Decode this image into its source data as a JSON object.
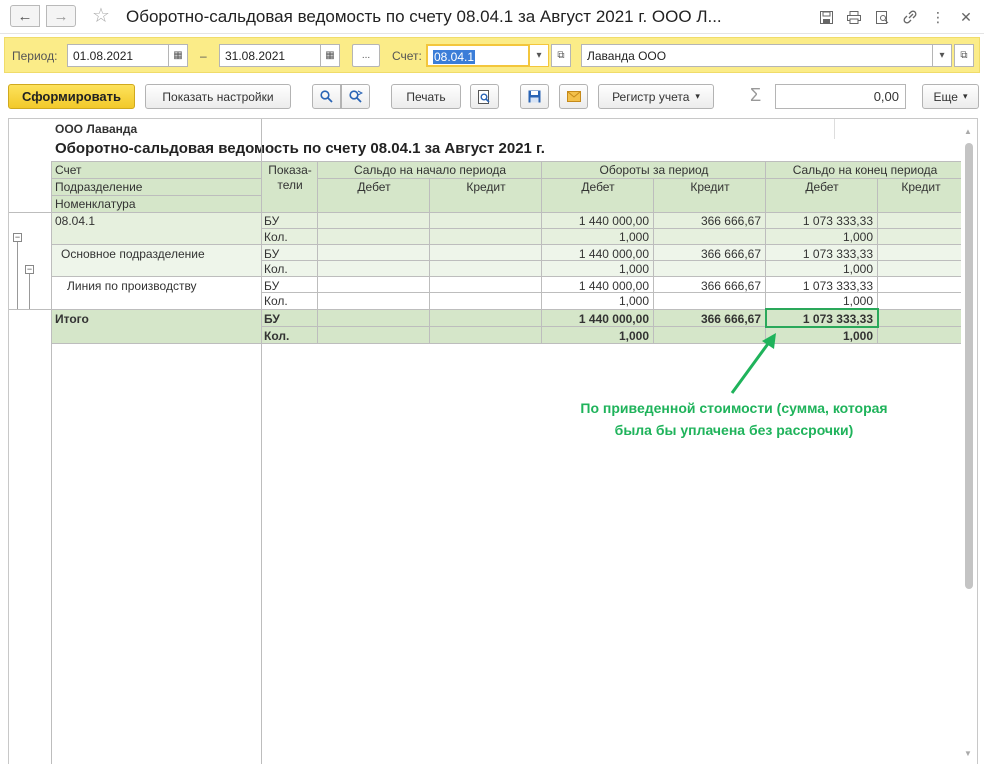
{
  "window": {
    "title": "Оборотно-сальдовая ведомость по счету 08.04.1 за Август 2021 г. ООО Л...",
    "back_icon": "arrow-left-icon",
    "forward_icon": "arrow-right-icon",
    "favorite_icon": "star-icon",
    "toolbar_icons": [
      "save-icon",
      "print-icon",
      "preview-icon",
      "link-icon",
      "more-icon",
      "close-icon"
    ]
  },
  "params": {
    "period_label": "Период:",
    "date_from": "01.08.2021",
    "dash": "–",
    "date_to": "31.08.2021",
    "ellipsis": "...",
    "account_label": "Счет:",
    "account_value": "08.04.1",
    "organization": "Лаванда ООО"
  },
  "toolbar": {
    "generate": "Сформировать",
    "show_settings": "Показать настройки",
    "print": "Печать",
    "register": "Регистр учета",
    "sum_value": "0,00",
    "more": "Еще"
  },
  "report": {
    "company": "ООО Лаванда",
    "heading": "Оборотно-сальдовая ведомость по счету 08.04.1 за Август 2021 г.",
    "col_account": "Счет",
    "col_division": "Подразделение",
    "col_nomenclature": "Номенклатура",
    "col_indicators_1": "Показа-",
    "col_indicators_2": "тели",
    "group_opening": "Сальдо на начало периода",
    "group_turnover": "Обороты за период",
    "group_closing": "Сальдо на конец периода",
    "debit": "Дебет",
    "credit": "Кредит",
    "rows": [
      {
        "name": "08.04.1",
        "ind1": "БУ",
        "ind2": "Кол.",
        "td1": "1 440 000,00",
        "td2": "1,000",
        "tc1": "366 666,67",
        "tc2": "",
        "cd1": "1 073 333,33",
        "cd2": "1,000"
      },
      {
        "name": "Основное подразделение",
        "ind1": "БУ",
        "ind2": "Кол.",
        "td1": "1 440 000,00",
        "td2": "1,000",
        "tc1": "366 666,67",
        "tc2": "",
        "cd1": "1 073 333,33",
        "cd2": "1,000"
      },
      {
        "name": "Линия по производству",
        "ind1": "БУ",
        "ind2": "Кол.",
        "td1": "1 440 000,00",
        "td2": "1,000",
        "tc1": "366 666,67",
        "tc2": "",
        "cd1": "1 073 333,33",
        "cd2": "1,000"
      }
    ],
    "total": {
      "name": "Итого",
      "ind1": "БУ",
      "ind2": "Кол.",
      "td1": "1 440 000,00",
      "td2": "1,000",
      "tc1": "366 666,67",
      "cd1": "1 073 333,33",
      "cd2": "1,000"
    }
  },
  "annotation": {
    "line1": "По приведенной стоимости (сумма, которая",
    "line2": "была бы уплачена без рассрочки)",
    "color": "#1fb35b"
  }
}
